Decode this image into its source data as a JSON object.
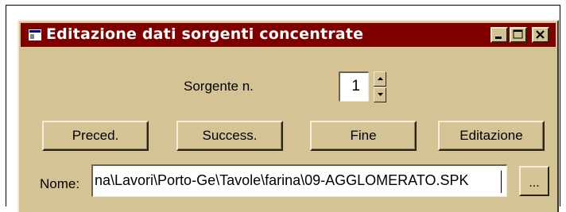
{
  "window": {
    "title": "Editazione dati sorgenti concentrate",
    "colors": {
      "titlebar": "#800000",
      "face": "#d4c495"
    }
  },
  "source": {
    "label": "Sorgente n.",
    "value": "1"
  },
  "buttons": {
    "prev": "Preced.",
    "next": "Success.",
    "end": "Fine",
    "edit": "Editazione"
  },
  "file": {
    "label": "Nome:",
    "value": "na\\Lavori\\Porto-Ge\\Tavole\\farina\\09-AGGLOMERATO.SPK",
    "browse": "..."
  },
  "icons": [
    "window-menu-icon",
    "minimize-icon",
    "maximize-icon",
    "close-icon",
    "spin-up-icon",
    "spin-down-icon"
  ]
}
